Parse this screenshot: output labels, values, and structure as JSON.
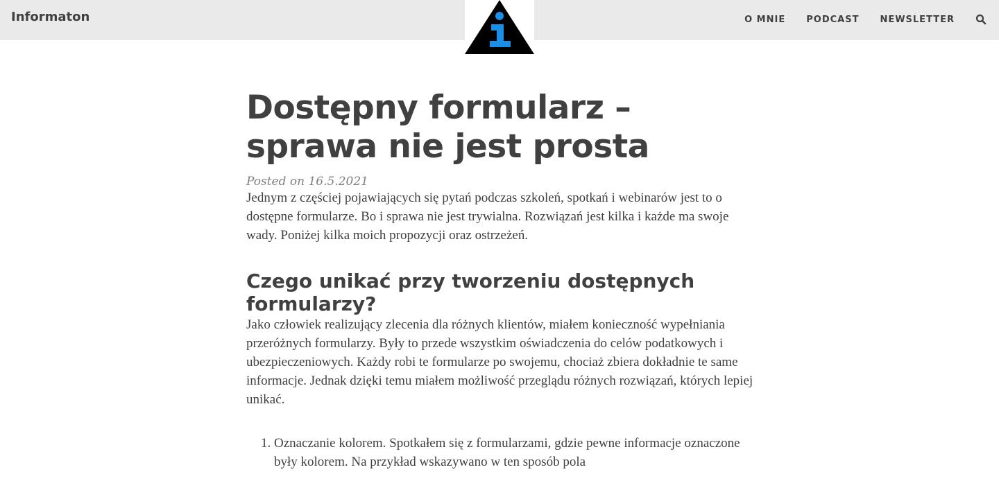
{
  "header": {
    "brand": "Informaton",
    "nav": [
      {
        "label": "O MNIE"
      },
      {
        "label": "PODCAST"
      },
      {
        "label": "NEWSLETTER"
      }
    ],
    "logo_colors": {
      "triangle": "#000000",
      "letter": "#1a8fe8"
    }
  },
  "post": {
    "title": "Dostępny formularz – sprawa nie jest prosta",
    "meta": "Posted on 16.5.2021",
    "intro": "Jednym z częściej pojawiających się pytań podczas szkoleń, spotkań i webinarów jest to o dostępne formularze. Bo i sprawa nie jest trywialna. Rozwiązań jest kilka i każde ma swoje wady. Poniżej kilka moich propozycji oraz ostrzeżeń.",
    "heading": "Czego unikać przy tworzeniu dostępnych formularzy?",
    "para2": "Jako człowiek realizujący zlecenia dla różnych klientów, miałem konieczność wypełniania przeróżnych formularzy. Były to przede wszystkim oświadczenia do celów podatkowych i ubezpieczeniowych. Każdy robi te formularze po swojemu, chociaż zbiera dokładnie te same informacje. Jednak dzięki temu miałem możliwość przeglądu różnych rozwiązań, których lepiej unikać.",
    "list": [
      {
        "text": "Oznaczanie kolorem. Spotkałem się z formularzami, gdzie pewne informacje oznaczone były kolorem. Na przykład wskazywano w ten sposób pola"
      }
    ]
  }
}
